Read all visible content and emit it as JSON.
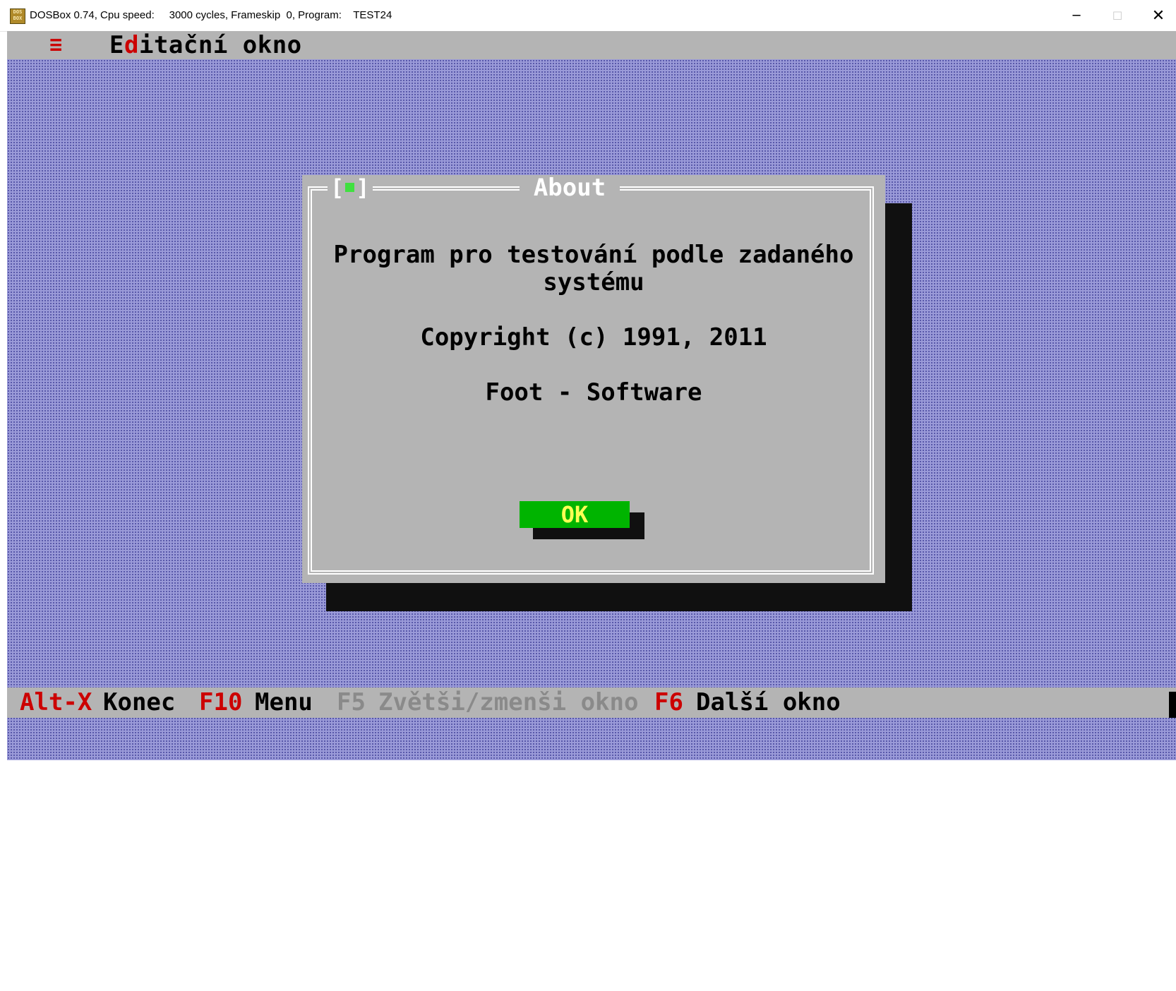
{
  "window": {
    "icon_text": "DOS BOX",
    "title": "DOSBox 0.74, Cpu speed:     3000 cycles, Frameskip  0, Program:    TEST24",
    "controls": {
      "minimize": "─",
      "maximize": "☐",
      "close": "✕"
    }
  },
  "menubar": {
    "system_menu_icon": "≡",
    "title_first": "E",
    "title_hot": "d",
    "title_rest": "itační okno"
  },
  "dialog": {
    "close_open": "[",
    "close_close": "]",
    "title": "About",
    "line1": "Program pro testování podle zadaného",
    "line2": "systému",
    "copyright": "Copyright (c) 1991, 2011",
    "company": "Foot - Software",
    "ok_label": "OK"
  },
  "statusbar": {
    "items": [
      {
        "key": "Alt-X",
        "label": "Konec",
        "enabled": true
      },
      {
        "key": "F10",
        "label": "Menu",
        "enabled": true
      },
      {
        "key": "F5",
        "label": "Zvětši/zmenši okno",
        "enabled": false
      },
      {
        "key": "F6",
        "label": "Další okno",
        "enabled": true
      }
    ]
  },
  "colors": {
    "desktop": "#9a9ad8",
    "panel": "#b4b4b4",
    "hotkey": "#cc0000",
    "ok_button": "#00b400",
    "ok_text": "#ffff54"
  }
}
